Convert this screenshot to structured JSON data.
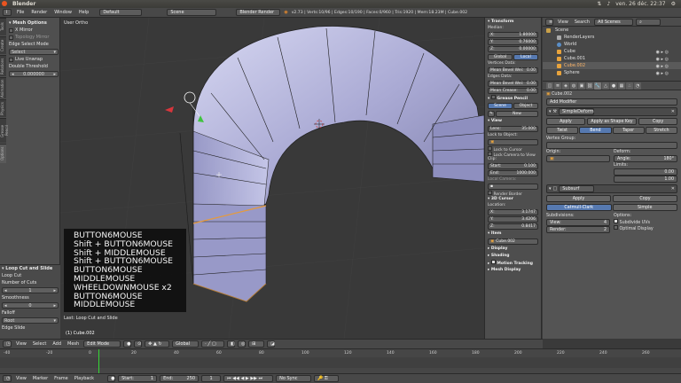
{
  "os_bar": {
    "title": "Blender",
    "clock": "ven. 26 déc. 22:37"
  },
  "info_header": {
    "menus": [
      "File",
      "Render",
      "Window",
      "Help"
    ],
    "screen_layout": "Default",
    "scene": "Scene",
    "render_engine": "Blender Render",
    "stats": "v2.73 | Verts:10/96 | Edges:10/190 | Faces:0/960 | Tris:1920 | Mem:18.23M | Cube.002"
  },
  "toolshelf": {
    "tabs": [
      "Tools",
      "Create",
      "Relations",
      "Animation",
      "Physics",
      "Grease Pencil",
      "Options"
    ],
    "mesh_options_header": "Mesh Options",
    "x_mirror": "X Mirror",
    "topology_mirror": "Topology Mirror",
    "edge_select_mode_label": "Edge Select Mode",
    "edge_select_mode_value": "Select",
    "live_unwrap": "Live Unwrap",
    "double_threshold_label": "Double Threshold",
    "double_threshold_value": "0.000000",
    "operator_header": "Loop Cut and Slide",
    "loopcut_label": "Loop Cut",
    "cuts_label": "Number of Cuts",
    "cuts_value": "1",
    "smoothness_label": "Smoothness",
    "smoothness_value": "0",
    "falloff_label": "Falloff",
    "falloff_value": "Root",
    "edge_slide_label": "Edge Slide"
  },
  "viewport": {
    "view_label": "User Ortho",
    "object_label": "(1) Cube.002",
    "last_operator": "Last: Loop Cut and Slide",
    "key_log": [
      "BUTTON6MOUSE",
      "Shift + BUTTON6MOUSE",
      "Shift + MIDDLEMOUSE",
      "Shift + BUTTON6MOUSE",
      "BUTTON6MOUSE",
      "MIDDLEMOUSE",
      "WHEELDOWNMOUSE x2",
      "BUTTON6MOUSE",
      "MIDDLEMOUSE"
    ]
  },
  "npanel": {
    "transform_header": "Transform",
    "median_label": "Median:",
    "x_label": "X:",
    "x_value": "1.80000",
    "y_label": "Y:",
    "y_value": "0.76000",
    "z_label": "Z:",
    "z_value": "0.00000",
    "global_btn": "Global",
    "local_btn": "Local",
    "vertices_data": "Vertices Data:",
    "mean_bevel_weight": "Mean Bevel Wei:",
    "mean_bevel_weight_value": "0.00",
    "edges_data": "Edges Data:",
    "mean_bevel_weight2": "Mean Bevel Wei:",
    "mean_bevel_weight2_value": "0.00",
    "mean_crease": "Mean Crease:",
    "mean_crease_value": "0.00",
    "grease_pencil_header": "Grease Pencil",
    "gp_scene": "Scene",
    "gp_object": "Object",
    "gp_new": "New",
    "view_header": "View",
    "lens_label": "Lens:",
    "lens_value": "35.000",
    "lock_to_object": "Lock to Object:",
    "lock_to_cursor": "Lock to Cursor",
    "lock_camera": "Lock Camera to View",
    "clip_label": "Clip:",
    "clip_start_label": "Start:",
    "clip_start_value": "0.100",
    "clip_end_label": "End:",
    "clip_end_value": "1000.000",
    "local_camera": "Local Camera:",
    "render_border": "Render Border",
    "cursor_header": "3D Cursor",
    "location_label": "Location:",
    "cx_value": "3.1747",
    "cy_value": "3.4206",
    "cz_value": "0.8417",
    "item_header": "Item",
    "item_name": "Cube.002",
    "display_header": "Display",
    "shading_header": "Shading",
    "motion_header": "Motion Tracking",
    "mesh_display_header": "Mesh Display"
  },
  "outliner": {
    "view_menu": "View",
    "search_menu": "Search",
    "filter": "All Scenes",
    "rows": [
      "Scene",
      "RenderLayers",
      "World",
      "Cube",
      "Cube.001",
      "Cube.002",
      "Sphere"
    ]
  },
  "properties": {
    "breadcrumb": "Cube.002",
    "add_modifier": "Add Modifier",
    "mod1_name": "SimpleDeform",
    "apply": "Apply",
    "apply_shape": "Apply as Shape Key",
    "copy": "Copy",
    "twist": "Twist",
    "bend": "Bend",
    "taper": "Taper",
    "stretch": "Stretch",
    "vertex_group": "Vertex Group:",
    "origin_label": "Origin:",
    "deform_label": "Deform:",
    "angle_label": "Angle:",
    "angle_value": "180°",
    "limits_label": "Limits:",
    "limit_min": "0.00",
    "limit_max": "1.00",
    "mod2_name": "Subsurf",
    "apply2": "Apply",
    "copy2": "Copy",
    "catmull": "Catmull-Clark",
    "simple": "Simple",
    "subdivisions": "Subdivisions:",
    "options": "Options:",
    "view_label": "View:",
    "view_value": "4",
    "render_label": "Render:",
    "render_value": "2",
    "subdivide_uvs": "Subdivide UVs",
    "optimal_display": "Optimal Display"
  },
  "viewport_header": {
    "menus": [
      "View",
      "Select",
      "Add",
      "Mesh"
    ],
    "mode": "Edit Mode",
    "pivot": "Global"
  },
  "timeline": {
    "ticks": [
      "-40",
      "-20",
      "0",
      "20",
      "40",
      "60",
      "80",
      "100",
      "120",
      "140",
      "160",
      "180",
      "200",
      "220",
      "240",
      "260"
    ],
    "menus": [
      "View",
      "Marker",
      "Frame",
      "Playback"
    ],
    "start_label": "Start:",
    "start_value": "1",
    "end_label": "End:",
    "end_value": "250",
    "current_frame": "1",
    "sync": "No Sync",
    "current_frame_position": 0.144
  },
  "colors": {
    "accent": "#5679b0",
    "mesh": "#a9aad4",
    "selection": "#e69a3c"
  }
}
